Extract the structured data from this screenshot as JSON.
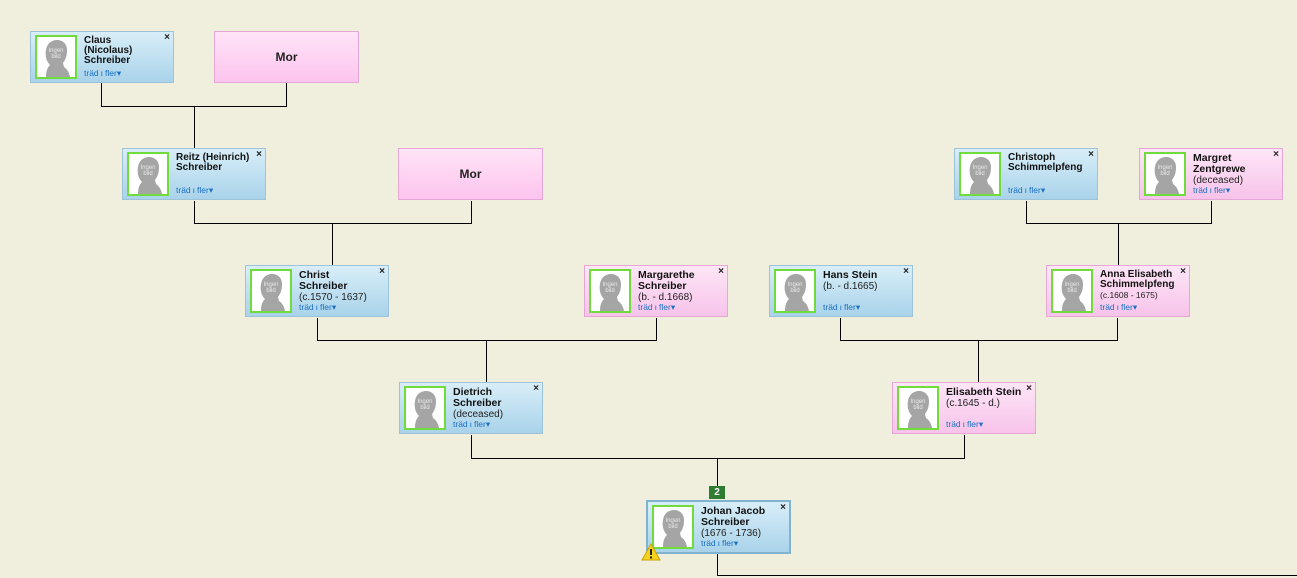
{
  "persons": {
    "claus": {
      "name": "Claus (Nicolaus) Schreiber",
      "dates": ""
    },
    "reitz": {
      "name": "Reitz (Heinrich) Schreiber",
      "dates": ""
    },
    "christ": {
      "name": "Christ Schreiber",
      "dates": "(c.1570 - 1637)"
    },
    "margarethe": {
      "name": "Margarethe Schreiber",
      "dates": "(b. - d.1668)"
    },
    "hans": {
      "name": "Hans Stein",
      "dates": "(b. - d.1665)"
    },
    "christoph": {
      "name": "Christoph Schimmelpfeng",
      "dates": ""
    },
    "margret": {
      "name": "Margret Zentgrewe",
      "dates": "(deceased)"
    },
    "anna": {
      "name": "Anna Elisabeth Schimmelpfeng",
      "dates": "(c.1608 - 1675)"
    },
    "dietrich": {
      "name": "Dietrich Schreiber",
      "dates": "(deceased)"
    },
    "elisabeth": {
      "name": "Elisabeth Stein",
      "dates": "(c.1645 - d.)"
    },
    "johan": {
      "name": "Johan Jacob Schreiber",
      "dates": "(1676 - 1736)"
    }
  },
  "placeholders": {
    "mother_label": "Mor"
  },
  "card_links": {
    "tree": "träd",
    "separator": "ı",
    "more": "fler▾"
  },
  "close_glyph": "×",
  "children_badge": "2",
  "photo_placeholder_text": "Ingen bild",
  "colors": {
    "male": "#a9d3ea",
    "female": "#f7c3ea",
    "photo_border": "#6fdc3c",
    "badge": "#2f7d32",
    "connector": "#000000"
  },
  "icons": {
    "warning": "warning-icon",
    "silhouette": "person-silhouette-icon"
  }
}
